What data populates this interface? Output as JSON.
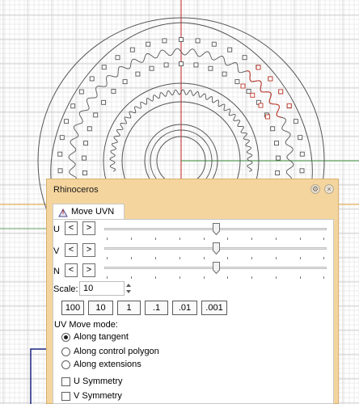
{
  "panel": {
    "title": "Rhinoceros",
    "tab_label": "Move UVN"
  },
  "axes": [
    {
      "label": "U",
      "left": "<",
      "right": ">",
      "value": 0.5
    },
    {
      "label": "V",
      "left": "<",
      "right": ">",
      "value": 0.5
    },
    {
      "label": "N",
      "left": "<",
      "right": ">",
      "value": 0.5
    }
  ],
  "scale": {
    "label": "Scale:",
    "value": "10"
  },
  "presets": [
    "100",
    "10",
    "1",
    ".1",
    ".01",
    ".001"
  ],
  "move_mode": {
    "title": "UV Move mode:",
    "options": [
      {
        "label": "Along tangent",
        "selected": true
      },
      {
        "label": "Along control polygon",
        "selected": false
      },
      {
        "label": "Along extensions",
        "selected": false
      }
    ]
  },
  "symmetry": {
    "u_label": "U Symmetry",
    "u_checked": false,
    "v_label": "V Symmetry",
    "v_checked": false
  },
  "colors": {
    "panel_bg": "#f5d59e",
    "grid_line": "#dcdcdc",
    "major_grid": "#c9c9c9",
    "x_axis": "#c61e1e",
    "y_axis": "#3c8c3c",
    "curve": "#555555",
    "highlight": "#c0392b",
    "construction_line": "#e2a43a",
    "selection": "#1a237e"
  }
}
